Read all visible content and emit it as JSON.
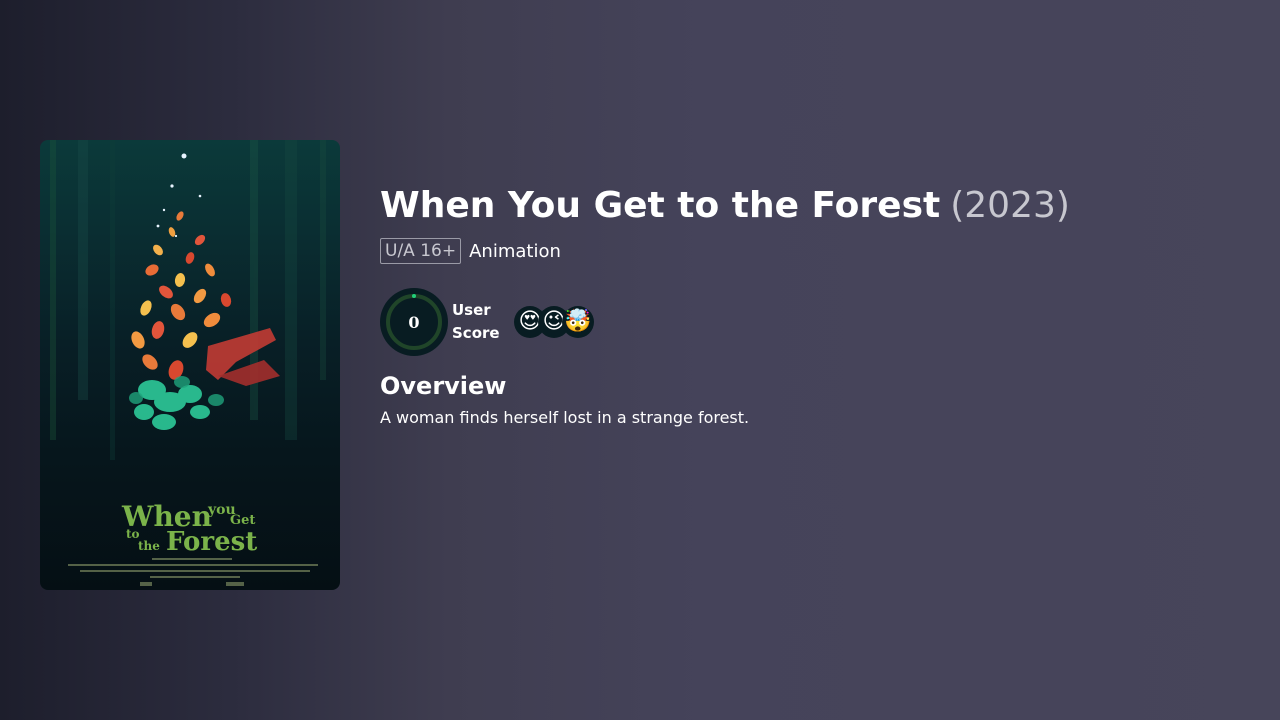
{
  "movie": {
    "title": "When You Get to the Forest",
    "year": "(2023)",
    "certification": "U/A 16+",
    "genres": "Animation",
    "user_score": "0",
    "user_score_label_line1": "User",
    "user_score_label_line2": "Score",
    "reactions": [
      "😍",
      "😉",
      "🤯"
    ],
    "overview_heading": "Overview",
    "overview": "A woman finds herself lost in a strange forest."
  },
  "poster": {
    "title_line1": "When",
    "title_line2": "you",
    "title_line3": "Get",
    "title_line4": "to",
    "title_line5": "the",
    "title_line6": "Forest",
    "accent_color": "#7bb34a"
  },
  "colors": {
    "score_ring_track": "#204529",
    "score_ring": "#21d07a",
    "background": "#45435a"
  }
}
